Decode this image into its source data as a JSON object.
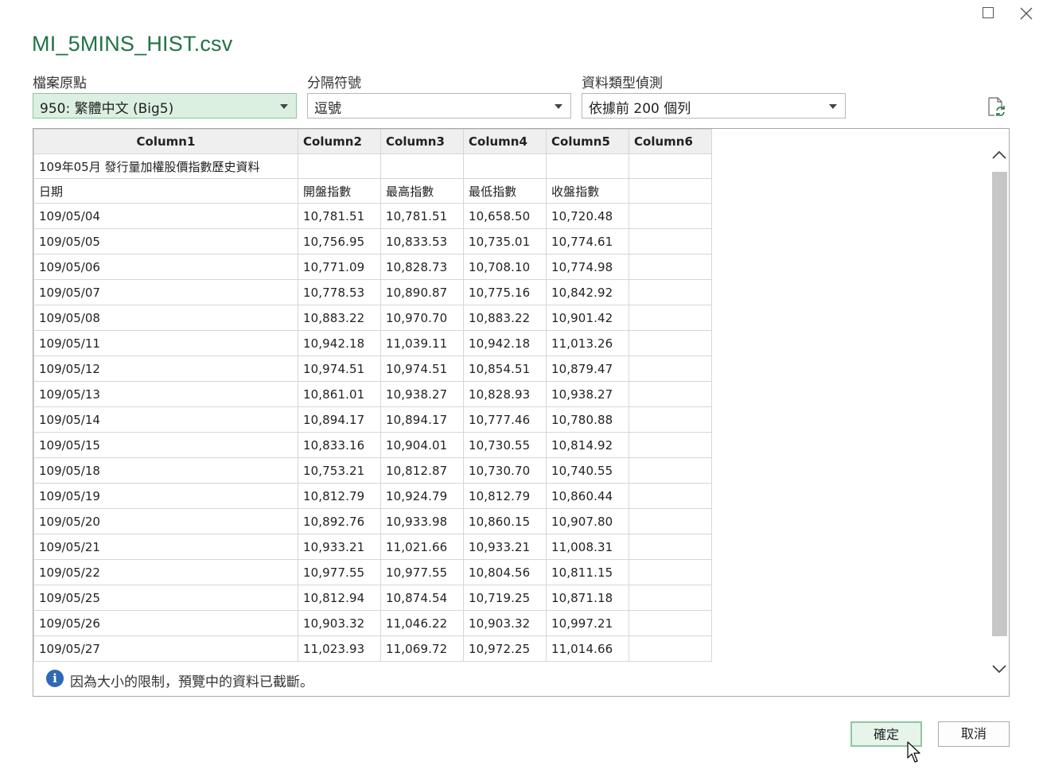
{
  "window": {
    "title": "MI_5MINS_HIST.csv"
  },
  "options": {
    "origin_label": "檔案原點",
    "origin_value": "950: 繁體中文 (Big5)",
    "delimiter_label": "分隔符號",
    "delimiter_value": "逗號",
    "detect_label": "資料類型偵測",
    "detect_value": "依據前 200 個列"
  },
  "table": {
    "headers": [
      "Column1",
      "Column2",
      "Column3",
      "Column4",
      "Column5",
      "Column6"
    ],
    "rows": [
      [
        "109年05月 發行量加權股價指數歷史資料",
        "",
        "",
        "",
        "",
        ""
      ],
      [
        "日期",
        "開盤指數",
        "最高指數",
        "最低指數",
        "收盤指數",
        ""
      ],
      [
        "109/05/04",
        "10,781.51",
        "10,781.51",
        "10,658.50",
        "10,720.48",
        ""
      ],
      [
        "109/05/05",
        "10,756.95",
        "10,833.53",
        "10,735.01",
        "10,774.61",
        ""
      ],
      [
        "109/05/06",
        "10,771.09",
        "10,828.73",
        "10,708.10",
        "10,774.98",
        ""
      ],
      [
        "109/05/07",
        "10,778.53",
        "10,890.87",
        "10,775.16",
        "10,842.92",
        ""
      ],
      [
        "109/05/08",
        "10,883.22",
        "10,970.70",
        "10,883.22",
        "10,901.42",
        ""
      ],
      [
        "109/05/11",
        "10,942.18",
        "11,039.11",
        "10,942.18",
        "11,013.26",
        ""
      ],
      [
        "109/05/12",
        "10,974.51",
        "10,974.51",
        "10,854.51",
        "10,879.47",
        ""
      ],
      [
        "109/05/13",
        "10,861.01",
        "10,938.27",
        "10,828.93",
        "10,938.27",
        ""
      ],
      [
        "109/05/14",
        "10,894.17",
        "10,894.17",
        "10,777.46",
        "10,780.88",
        ""
      ],
      [
        "109/05/15",
        "10,833.16",
        "10,904.01",
        "10,730.55",
        "10,814.92",
        ""
      ],
      [
        "109/05/18",
        "10,753.21",
        "10,812.87",
        "10,730.70",
        "10,740.55",
        ""
      ],
      [
        "109/05/19",
        "10,812.79",
        "10,924.79",
        "10,812.79",
        "10,860.44",
        ""
      ],
      [
        "109/05/20",
        "10,892.76",
        "10,933.98",
        "10,860.15",
        "10,907.80",
        ""
      ],
      [
        "109/05/21",
        "10,933.21",
        "11,021.66",
        "10,933.21",
        "11,008.31",
        ""
      ],
      [
        "109/05/22",
        "10,977.55",
        "10,977.55",
        "10,804.56",
        "10,811.15",
        ""
      ],
      [
        "109/05/25",
        "10,812.94",
        "10,874.54",
        "10,719.25",
        "10,871.18",
        ""
      ],
      [
        "109/05/26",
        "10,903.32",
        "11,046.22",
        "10,903.32",
        "10,997.21",
        ""
      ],
      [
        "109/05/27",
        "11,023.93",
        "11,069.72",
        "10,972.25",
        "11,014.66",
        ""
      ]
    ]
  },
  "notice": {
    "text": "因為大小的限制，預覽中的資料已截斷。"
  },
  "buttons": {
    "ok": "確定",
    "cancel": "取消"
  },
  "colors": {
    "accent": "#217346",
    "selected_bg": "#dbf0e1",
    "info_icon": "#2e69b3"
  }
}
